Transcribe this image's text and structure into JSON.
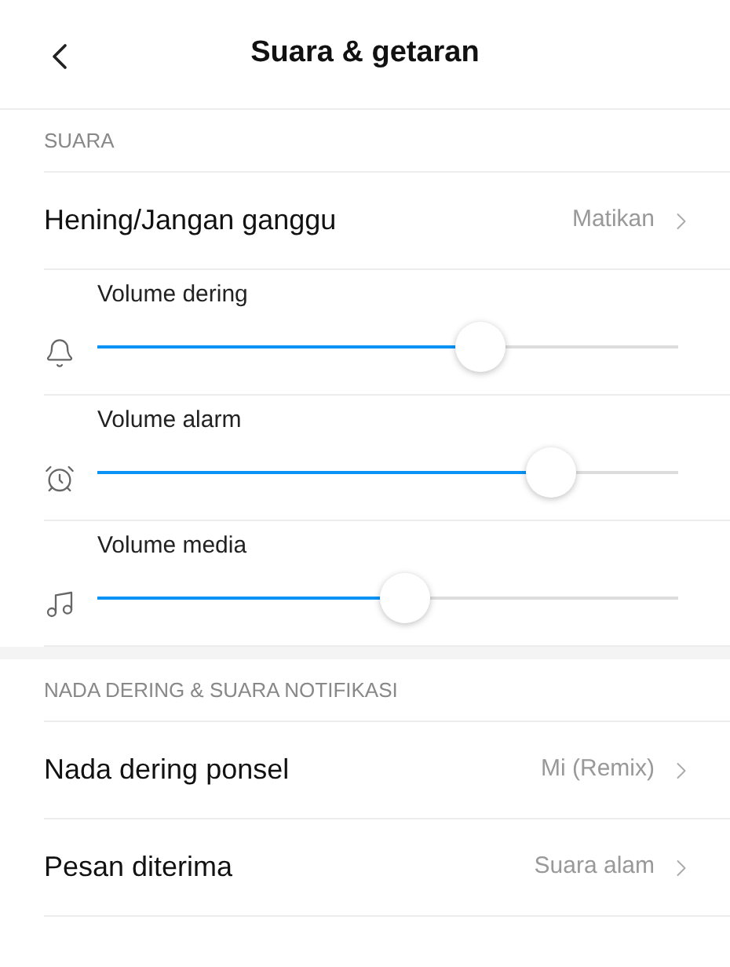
{
  "header": {
    "title": "Suara & getaran"
  },
  "sections": [
    {
      "label": "SUARA",
      "items": [
        {
          "kind": "link",
          "title": "Hening/Jangan ganggu",
          "value": "Matikan"
        },
        {
          "kind": "slider",
          "title": "Volume dering",
          "level": 0.66
        },
        {
          "kind": "slider",
          "title": "Volume alarm",
          "level": 0.78
        },
        {
          "kind": "slider",
          "title": "Volume media",
          "level": 0.53
        }
      ]
    },
    {
      "label": "NADA DERING & SUARA NOTIFIKASI",
      "items": [
        {
          "kind": "link",
          "title": "Nada dering ponsel",
          "value": "Mi (Remix)"
        },
        {
          "kind": "link",
          "title": "Pesan diterima",
          "value": "Suara alam"
        }
      ]
    }
  ]
}
